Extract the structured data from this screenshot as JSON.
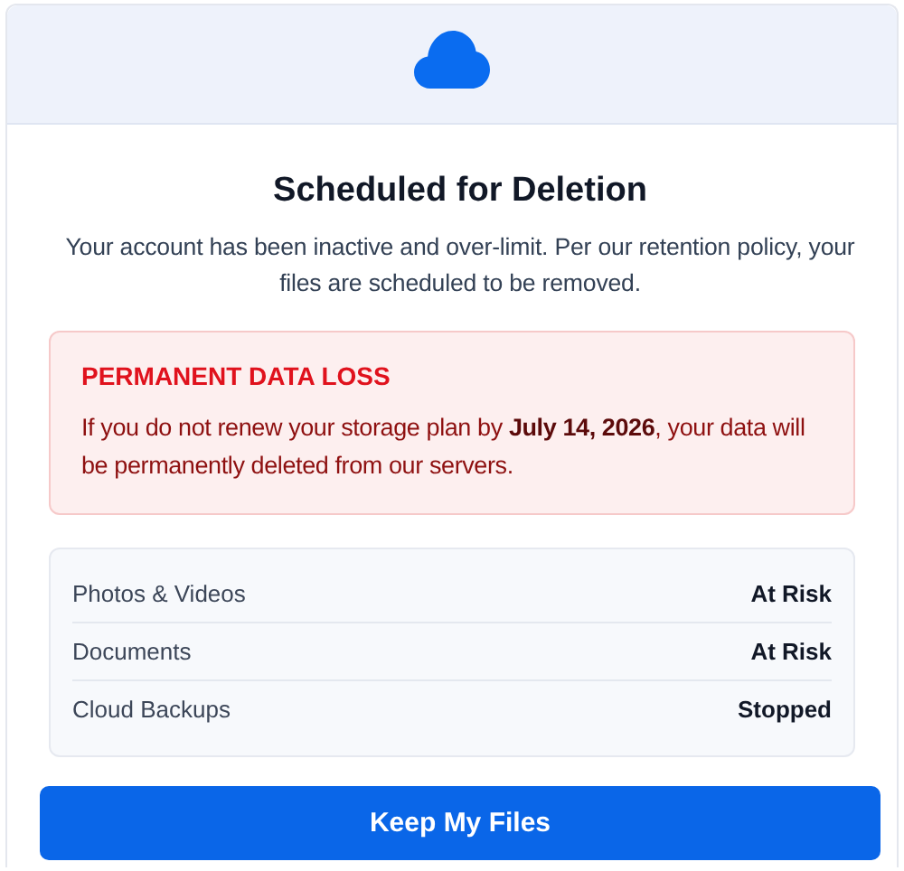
{
  "title": "Scheduled for Deletion",
  "description": "Your account has been inactive and over-limit. Per our retention policy, your files are scheduled to be removed.",
  "alert": {
    "title": "PERMANENT DATA LOSS",
    "message": "If you do not renew your storage plan by **July 14, 2026**, your data will be permanently deleted from our servers."
  },
  "items": [
    {
      "name": "Photos & Videos",
      "status": "At Risk"
    },
    {
      "name": "Documents",
      "status": "At Risk"
    },
    {
      "name": "Cloud Backups",
      "status": "Stopped"
    }
  ],
  "button": {
    "label": "Keep My Files"
  }
}
